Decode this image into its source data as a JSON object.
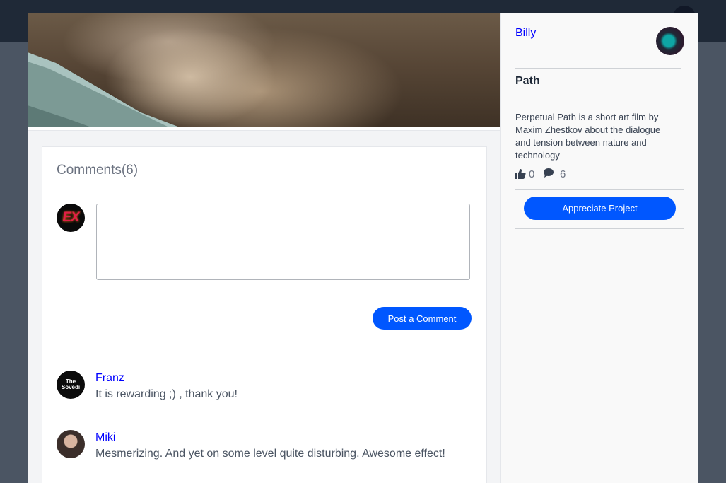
{
  "project": {
    "owner_name": "Billy",
    "title": "Path",
    "description": "Perpetual Path is a short art film by Maxim Zhestkov about the dialogue and tension between nature and technology",
    "appreciations": "0",
    "comment_count": "6",
    "appreciate_label": "Appreciate Project"
  },
  "comments": {
    "title": "Comments(6)",
    "input_placeholder": "",
    "post_label": "Post a Comment",
    "current_user_avatar_text": "EX",
    "items": [
      {
        "author": "Franz",
        "avatar_text": "The Sovedi",
        "text": "It is rewarding ;) , thank you!"
      },
      {
        "author": "Miki",
        "avatar_text": "",
        "text": "Mesmerizing. And yet on some level quite disturbing. Awesome effect!"
      }
    ]
  },
  "icons": {
    "thumbs_up": "thumbs-up-icon",
    "comment": "comment-bubble-icon"
  },
  "colors": {
    "accent": "#0057ff",
    "link": "#0000ff",
    "overlay": "#4b5563",
    "topbar": "#1f2937"
  }
}
